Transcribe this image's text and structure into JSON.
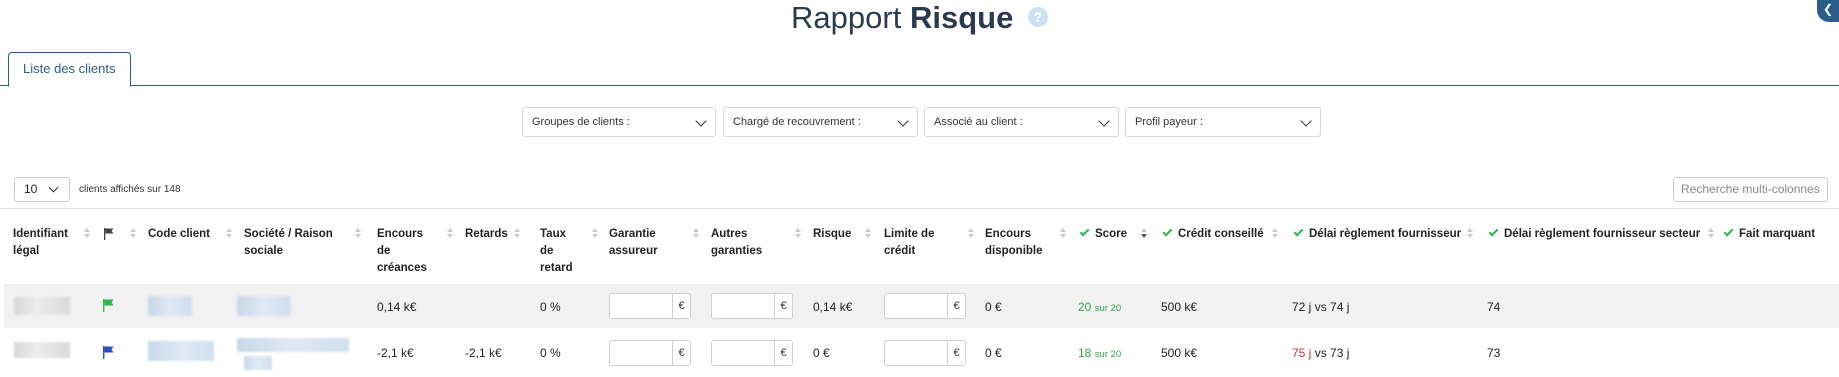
{
  "page": {
    "title_light": "Rapport",
    "title_bold": "Risque",
    "help_glyph": "?",
    "corner_glyph": "❮"
  },
  "tabs": [
    {
      "label": "Liste des clients"
    }
  ],
  "filters": [
    {
      "label": "Groupes de clients :"
    },
    {
      "label": "Chargé de recouvrement :"
    },
    {
      "label": "Associé au client :"
    },
    {
      "label": "Profil payeur :"
    }
  ],
  "table_controls": {
    "page_size": "10",
    "count_text": "clients affichés sur 148",
    "search_placeholder": "Recherche multi-colonnes"
  },
  "columns": [
    {
      "line1": "Identifiant",
      "line2": "légal",
      "line3": ""
    },
    {
      "line1": "Code client",
      "line2": "",
      "line3": ""
    },
    {
      "line1": "Société / Raison",
      "line2": "sociale",
      "line3": ""
    },
    {
      "line1": "Encours",
      "line2": "de",
      "line3": "créances"
    },
    {
      "line1": "Retards",
      "line2": "",
      "line3": ""
    },
    {
      "line1": "Taux",
      "line2": "de",
      "line3": "retard"
    },
    {
      "line1": "Garantie",
      "line2": "assureur",
      "line3": ""
    },
    {
      "line1": "Autres",
      "line2": "garanties",
      "line3": ""
    },
    {
      "line1": "Risque",
      "line2": "",
      "line3": ""
    },
    {
      "line1": "Limite de",
      "line2": "crédit",
      "line3": ""
    },
    {
      "line1": "Encours",
      "line2": "disponible",
      "line3": ""
    },
    {
      "line1": "Score",
      "line2": "",
      "line3": ""
    },
    {
      "line1": "Crédit conseillé",
      "line2": "",
      "line3": ""
    },
    {
      "line1": "Délai règlement fournisseur",
      "line2": "",
      "line3": ""
    },
    {
      "line1": "Délai règlement fournisseur secteur",
      "line2": "",
      "line3": ""
    },
    {
      "line1": "Fait marquant",
      "line2": "",
      "line3": ""
    }
  ],
  "rows": [
    {
      "flag_color": "#2fb54a",
      "encours": "0,14 k€",
      "retards": "",
      "taux": "0 %",
      "garantie_currency": "€",
      "autres_currency": "€",
      "risque": "0,14 k€",
      "limite_currency": "€",
      "disponible": "0 €",
      "score_value": "20",
      "score_max": "sur 20",
      "credit_conseille": "500 k€",
      "delai_client": "72 j",
      "delai_sep": " vs 74 j",
      "delai_secteur": "74"
    },
    {
      "flag_color": "#2a52be",
      "encours": "-2,1 k€",
      "retards": "-2,1 k€",
      "taux": "0 %",
      "garantie_currency": "€",
      "autres_currency": "€",
      "risque": "0 €",
      "limite_currency": "€",
      "disponible": "0 €",
      "score_value": "18",
      "score_max": "sur 20",
      "credit_conseille": "500 k€",
      "delai_client": "75 j",
      "delai_sep": " vs 73 j",
      "delai_secteur": "73"
    }
  ],
  "colors": {
    "accent": "#2b5c8a",
    "positive": "#2fa44a",
    "negative": "#d12f2f",
    "title": "#2b3a4e"
  }
}
